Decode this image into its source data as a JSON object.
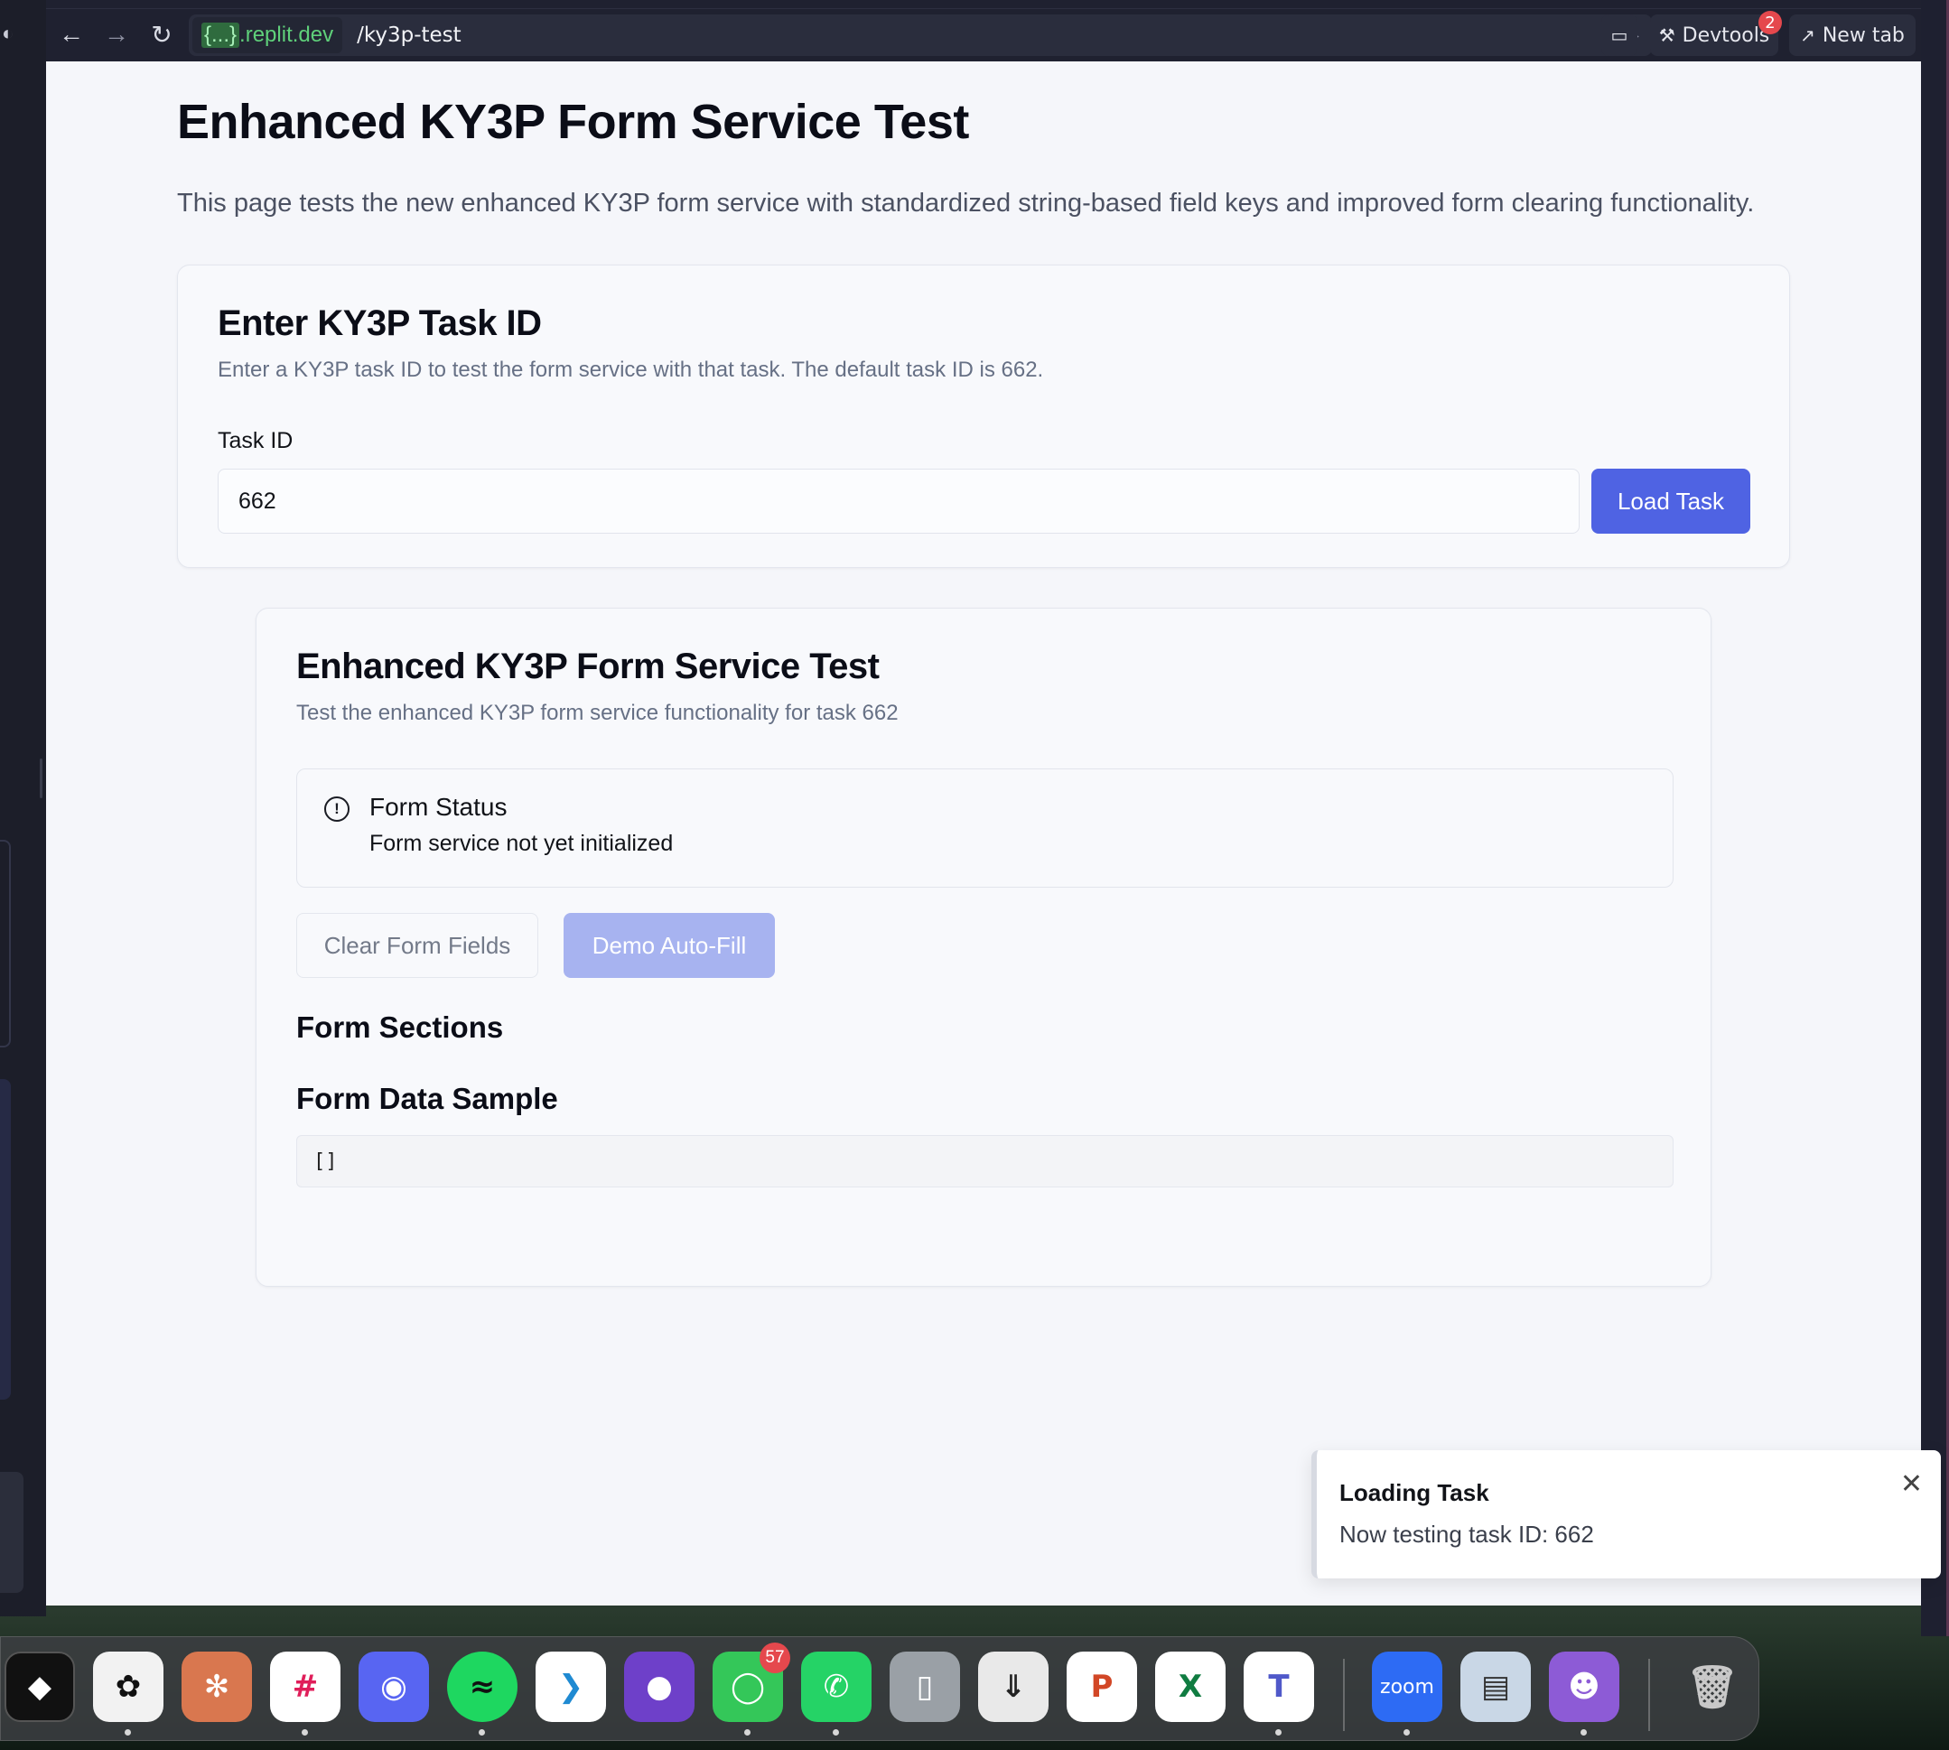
{
  "browser": {
    "host_brace": "{...}",
    "host_domain": ".replit.dev",
    "path": "/ky3p-test",
    "devtools_label": "Devtools",
    "devtools_badge": "2",
    "newtab_label": "New tab"
  },
  "page": {
    "title": "Enhanced KY3P Form Service Test",
    "description": "This page tests the new enhanced KY3P form service with standardized string-based field keys and improved form clearing functionality."
  },
  "task_card": {
    "title": "Enter KY3P Task ID",
    "subtitle": "Enter a KY3P task ID to test the form service with that task. The default task ID is 662.",
    "field_label": "Task ID",
    "field_value": "662",
    "load_button": "Load Task"
  },
  "test_card": {
    "title": "Enhanced KY3P Form Service Test",
    "subtitle": "Test the enhanced KY3P form service functionality for task 662",
    "status_title": "Form Status",
    "status_text": "Form service not yet initialized",
    "clear_button": "Clear Form Fields",
    "autofill_button": "Demo Auto-Fill",
    "sections_heading": "Form Sections",
    "data_heading": "Form Data Sample",
    "data_sample": "[]"
  },
  "toast": {
    "title": "Loading Task",
    "message": "Now testing task ID: 662"
  },
  "dock": {
    "messages_badge": "57",
    "zoom_label": "zoom"
  },
  "colors": {
    "primary": "#4f63e3",
    "primary_disabled": "#a7b3f0",
    "host_green": "#5fd07a",
    "badge_red": "#e5484d"
  }
}
